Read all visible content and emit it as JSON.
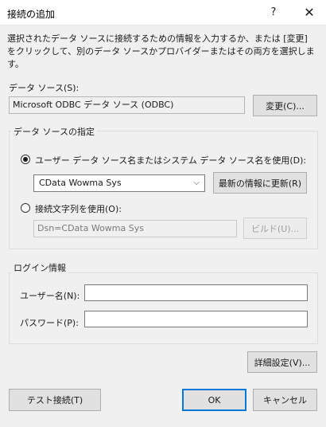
{
  "window": {
    "title": "接続の追加",
    "help_glyph": "?",
    "close_glyph": "✕"
  },
  "description": "選択されたデータ ソースに接続するための情報を入力するか、または [変更] をクリックして、別のデータ ソースかプロバイダーまたはその両方を選択します。",
  "data_source": {
    "label": "データ ソース(S):",
    "value": "Microsoft ODBC データ ソース (ODBC)",
    "change_button": "変更(C)..."
  },
  "source_spec": {
    "group_title": "データ ソースの指定",
    "radio_dsn_label": "ユーザー データ ソース名またはシステム データ ソース名を使用(D):",
    "dsn_selected": "CData Wowma Sys",
    "dsn_arrow": "⌵",
    "refresh_button": "最新の情報に更新(R)",
    "radio_connstr_label": "接続文字列を使用(O):",
    "connstr_value": "Dsn=CData Wowma Sys",
    "build_button": "ビルド(U)..."
  },
  "login": {
    "group_title": "ログイン情報",
    "username_label": "ユーザー名(N):",
    "username_value": "",
    "password_label": "パスワード(P):",
    "password_value": ""
  },
  "advanced_button": "詳細設定(V)...",
  "footer": {
    "test_button": "テスト接続(T)",
    "ok_button": "OK",
    "cancel_button": "キャンセル"
  }
}
